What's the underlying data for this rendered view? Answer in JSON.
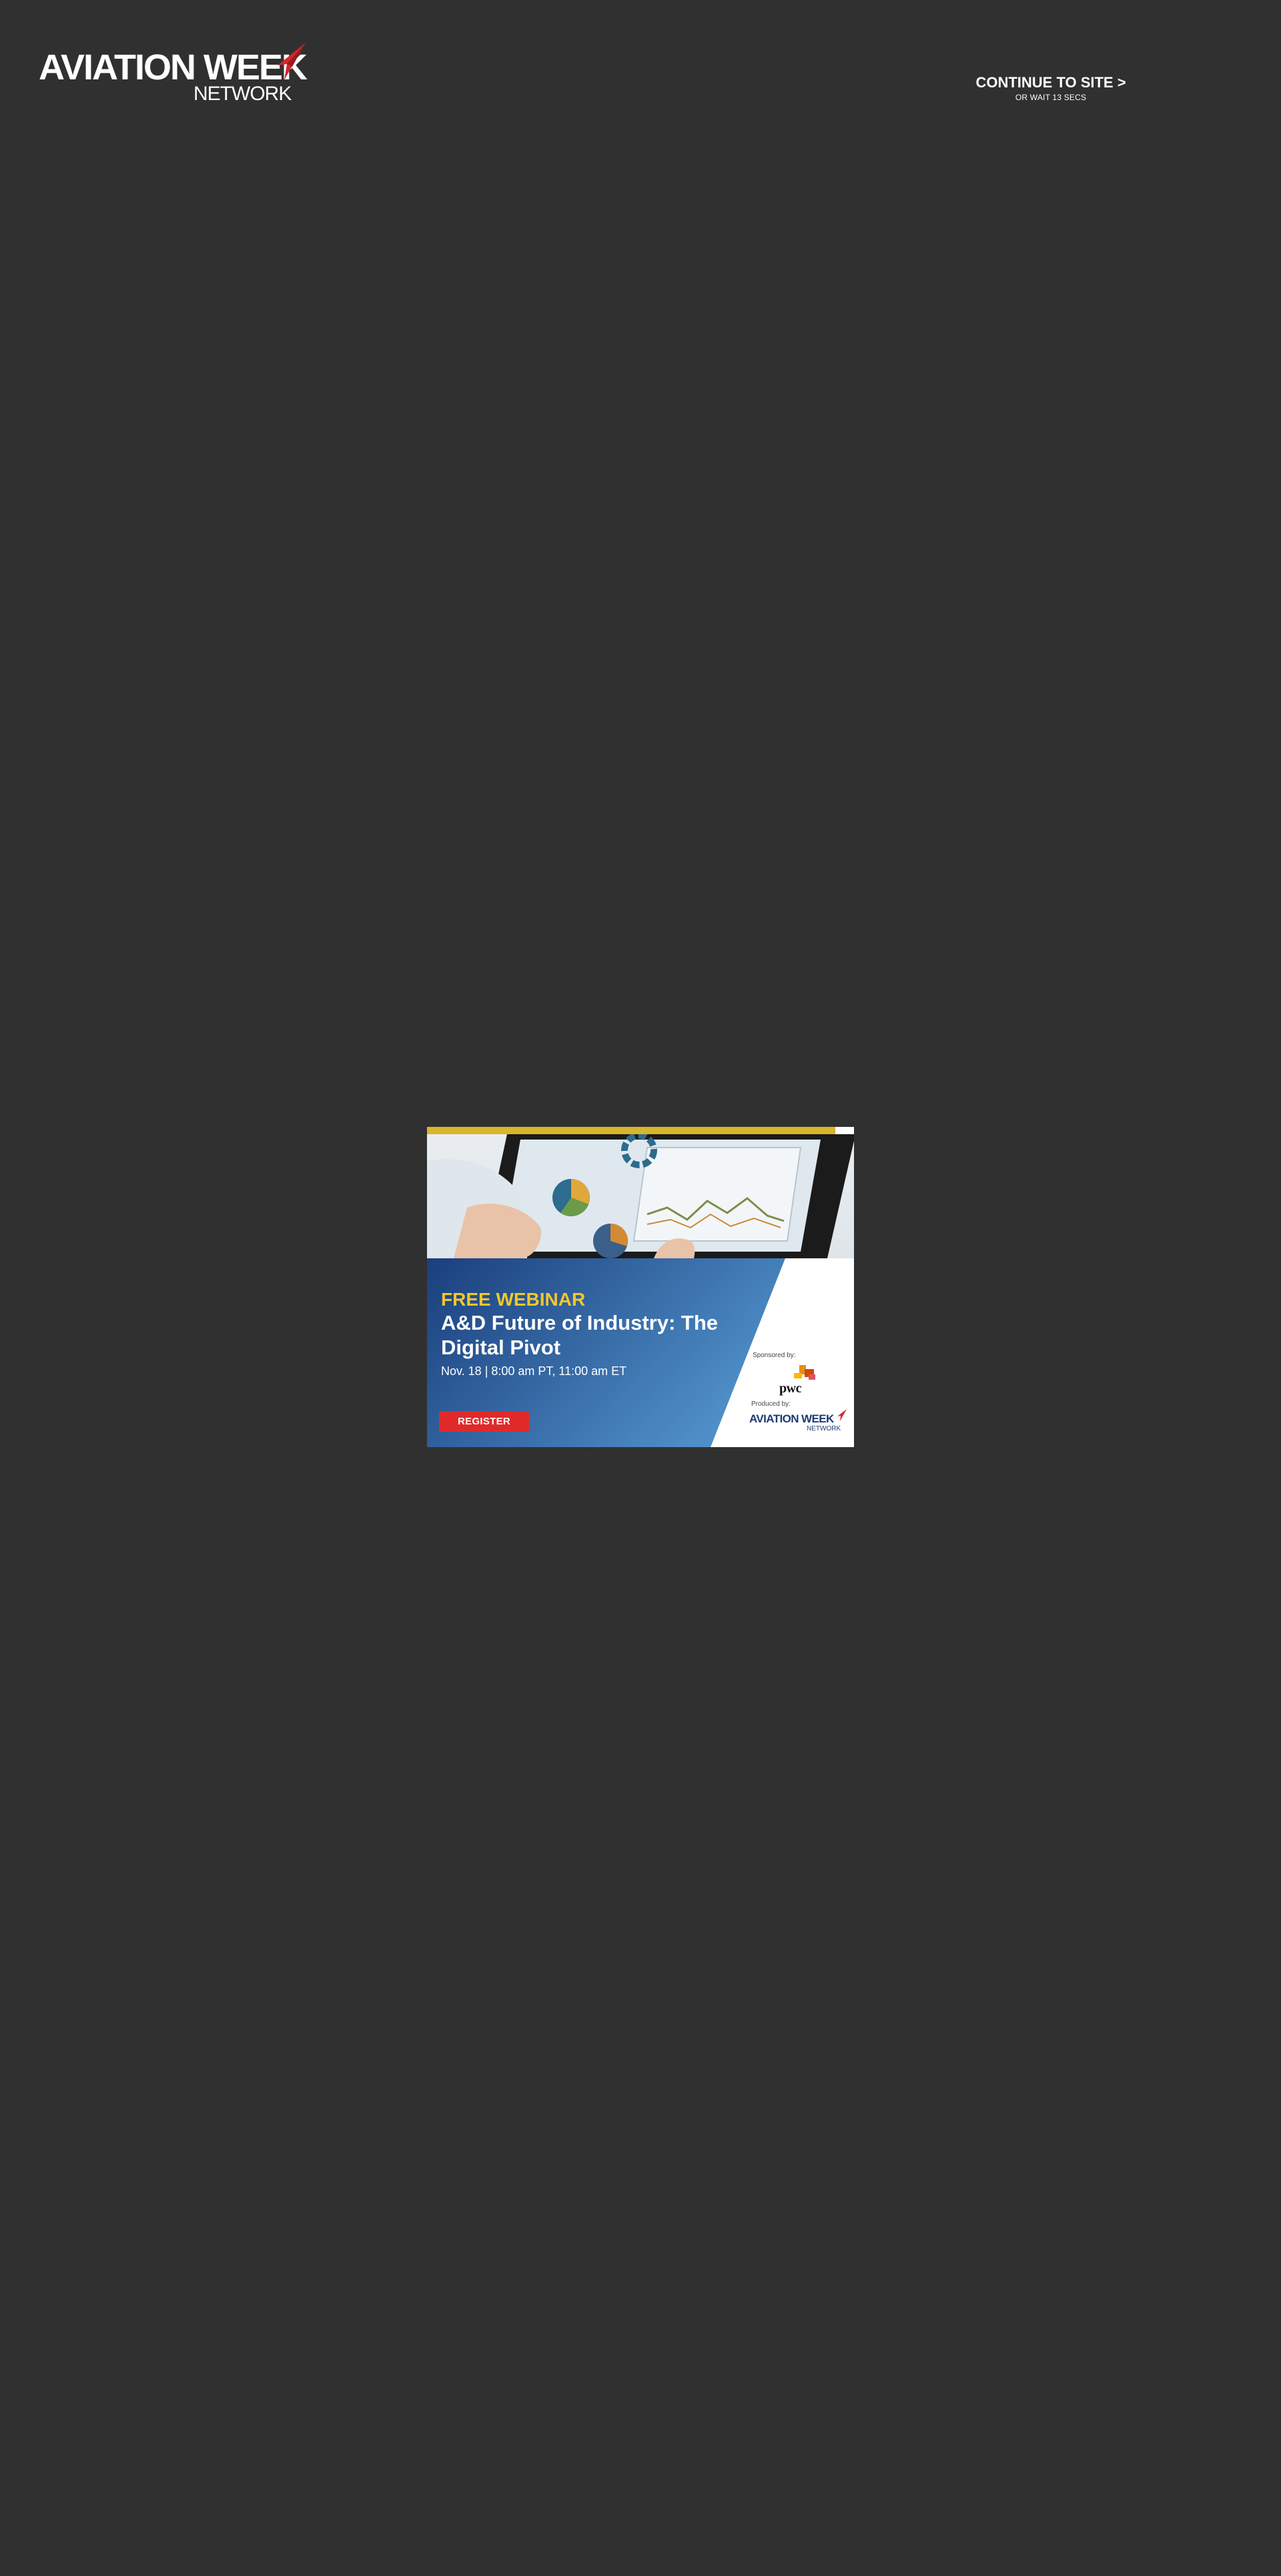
{
  "header": {
    "logo_text": "AVIATION WEEK",
    "logo_subtext": "NETWORK",
    "continue_label": "CONTINUE TO SITE >",
    "continue_wait": "OR WAIT 13 SECS"
  },
  "ad": {
    "kicker": "FREE WEBINAR",
    "title": "A&D Future of Industry: The Digital Pivot",
    "date": "Nov. 18 | 8:00 am PT, 11:00 am ET",
    "register_label": "REGISTER",
    "sponsored_label": "Sponsored by:",
    "sponsor_name": "pwc",
    "produced_label": "Produced by:",
    "producer_logo_text": "AVIATION WEEK",
    "producer_logo_subtext": "NETWORK"
  },
  "colors": {
    "page_background": "#303030",
    "accent_red": "#e02a2a",
    "ad_kicker_yellow": "#f2c72c",
    "ad_panel_blue": "#1f4d8f"
  }
}
